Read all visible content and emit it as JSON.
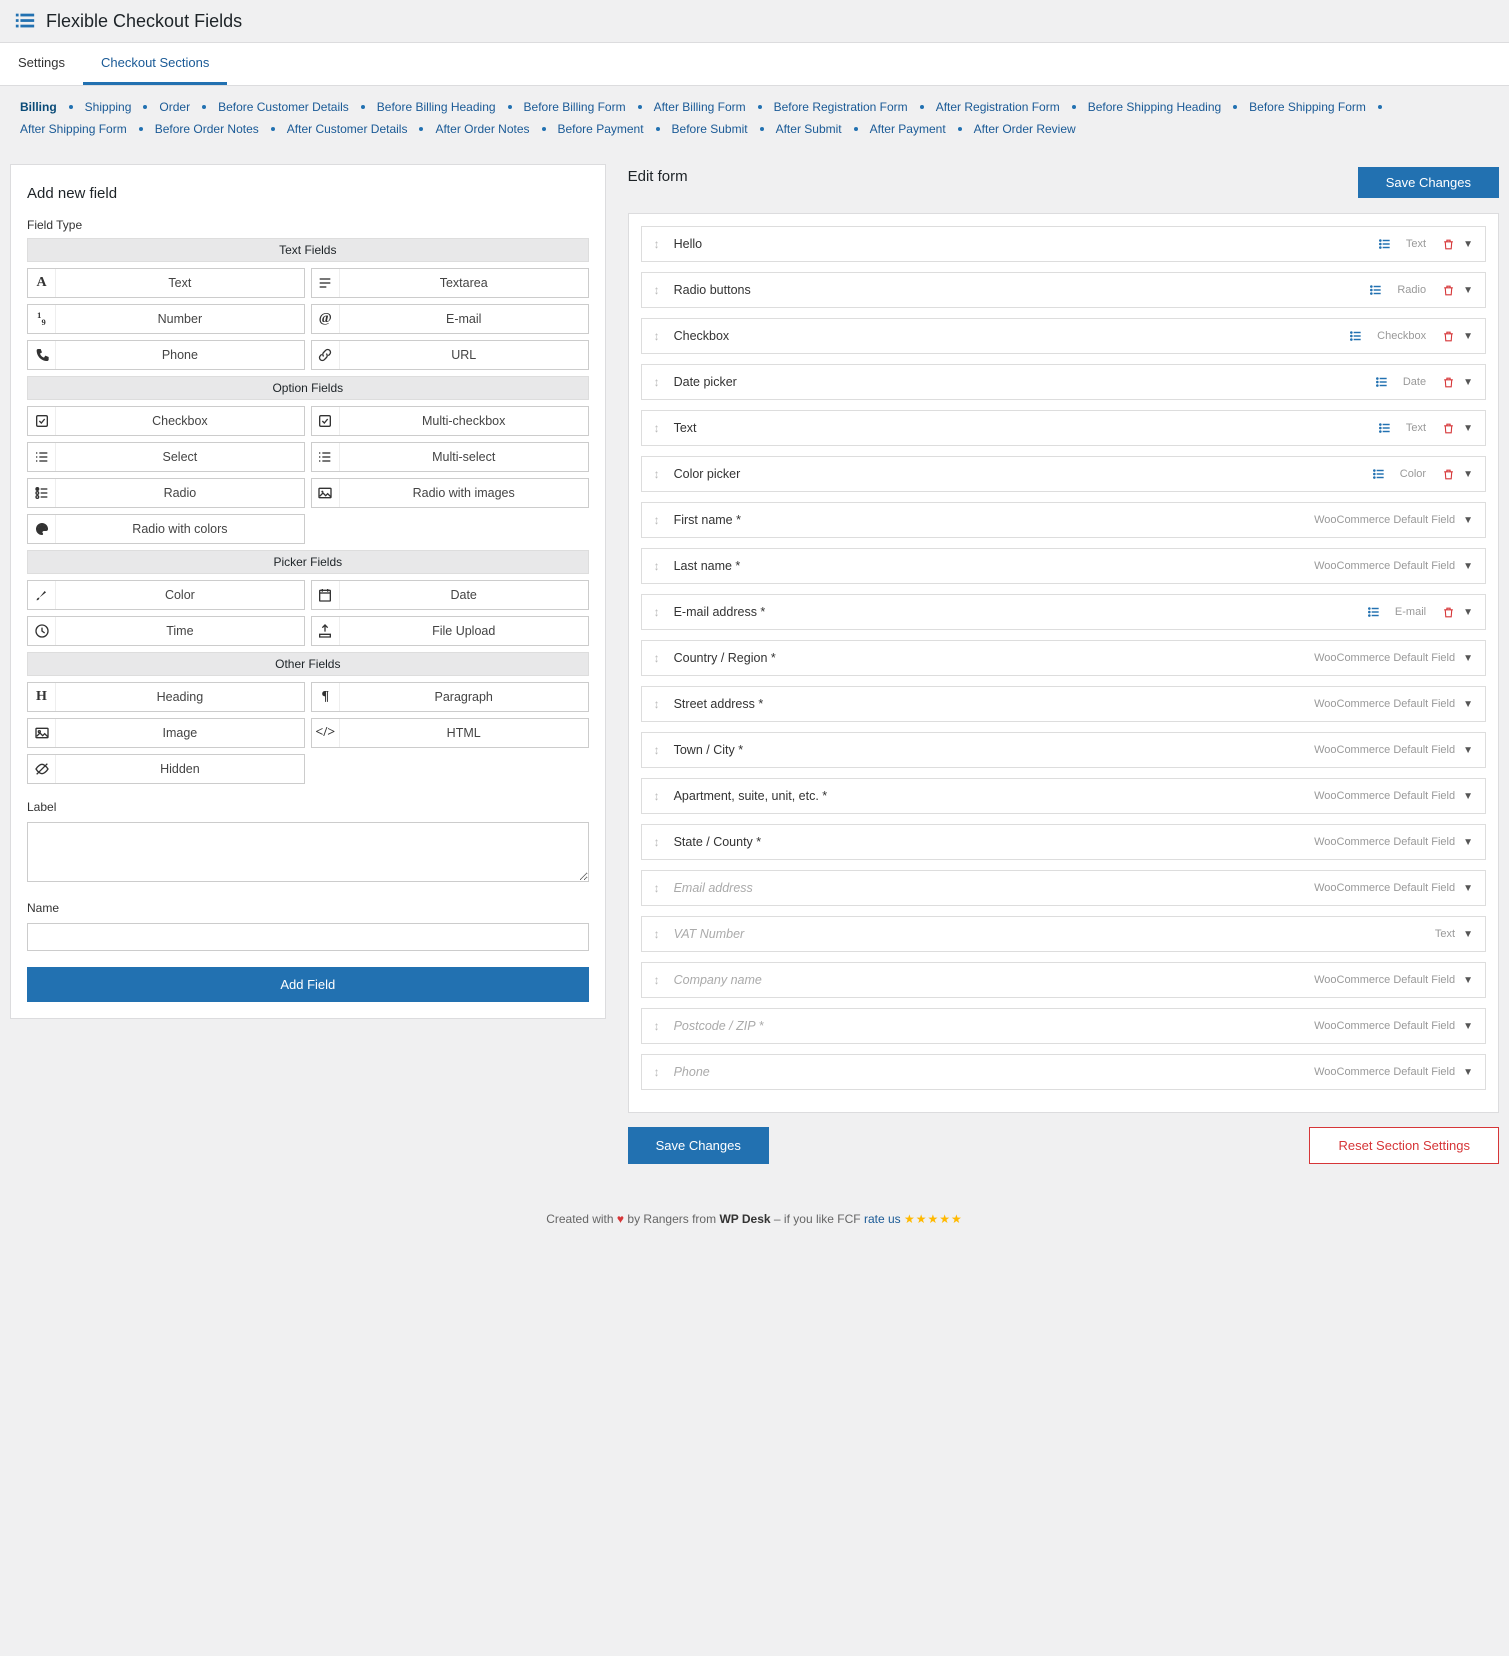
{
  "header": {
    "title": "Flexible Checkout Fields"
  },
  "tabs": [
    {
      "label": "Settings",
      "active": false
    },
    {
      "label": "Checkout Sections",
      "active": true
    }
  ],
  "sections": [
    "Billing",
    "Shipping",
    "Order",
    "Before Customer Details",
    "Before Billing Heading",
    "Before Billing Form",
    "After Billing Form",
    "Before Registration Form",
    "After Registration Form",
    "Before Shipping Heading",
    "Before Shipping Form",
    "After Shipping Form",
    "Before Order Notes",
    "After Customer Details",
    "After Order Notes",
    "Before Payment",
    "Before Submit",
    "After Submit",
    "After Payment",
    "After Order Review"
  ],
  "section_active": 0,
  "left": {
    "title": "Add new field",
    "field_type_label": "Field Type",
    "label_label": "Label",
    "name_label": "Name",
    "label_value": "",
    "name_value": "",
    "add_btn": "Add Field",
    "groups": [
      {
        "header": "Text Fields",
        "types": [
          {
            "icon": "A",
            "kind": "glyph",
            "label": "Text"
          },
          {
            "icon": "textarea",
            "kind": "svg",
            "label": "Textarea"
          },
          {
            "icon": "¹₉",
            "kind": "glyph",
            "label": "Number"
          },
          {
            "icon": "@",
            "kind": "glyph",
            "label": "E-mail"
          },
          {
            "icon": "phone",
            "kind": "svg",
            "label": "Phone"
          },
          {
            "icon": "link",
            "kind": "svg",
            "label": "URL"
          }
        ]
      },
      {
        "header": "Option Fields",
        "types": [
          {
            "icon": "checkbox",
            "kind": "svg",
            "label": "Checkbox"
          },
          {
            "icon": "checkbox",
            "kind": "svg",
            "label": "Multi-checkbox"
          },
          {
            "icon": "select",
            "kind": "svg",
            "label": "Select"
          },
          {
            "icon": "select",
            "kind": "svg",
            "label": "Multi-select"
          },
          {
            "icon": "radio",
            "kind": "svg",
            "label": "Radio"
          },
          {
            "icon": "radioimg",
            "kind": "svg",
            "label": "Radio with images"
          },
          {
            "icon": "palette",
            "kind": "svg",
            "label": "Radio with colors"
          }
        ]
      },
      {
        "header": "Picker Fields",
        "types": [
          {
            "icon": "brush",
            "kind": "svg",
            "label": "Color"
          },
          {
            "icon": "calendar",
            "kind": "svg",
            "label": "Date"
          },
          {
            "icon": "clock",
            "kind": "svg",
            "label": "Time"
          },
          {
            "icon": "upload",
            "kind": "svg",
            "label": "File Upload"
          }
        ]
      },
      {
        "header": "Other Fields",
        "types": [
          {
            "icon": "H",
            "kind": "glyph",
            "label": "Heading"
          },
          {
            "icon": "¶",
            "kind": "glyph",
            "label": "Paragraph"
          },
          {
            "icon": "image",
            "kind": "svg",
            "label": "Image"
          },
          {
            "icon": "</>",
            "kind": "glyph",
            "label": "HTML"
          },
          {
            "icon": "hidden",
            "kind": "svg",
            "label": "Hidden"
          }
        ]
      }
    ]
  },
  "right": {
    "title": "Edit form",
    "save_btn": "Save Changes",
    "reset_btn": "Reset Section Settings",
    "rows": [
      {
        "title": "Hello",
        "badge": "Text",
        "list_icon": true,
        "trash": true,
        "disabled": false
      },
      {
        "title": "Radio buttons",
        "badge": "Radio",
        "list_icon": true,
        "trash": true,
        "disabled": false
      },
      {
        "title": "Checkbox",
        "badge": "Checkbox",
        "list_icon": true,
        "trash": true,
        "disabled": false
      },
      {
        "title": "Date picker",
        "badge": "Date",
        "list_icon": true,
        "trash": true,
        "disabled": false
      },
      {
        "title": "Text",
        "badge": "Text",
        "list_icon": true,
        "trash": true,
        "disabled": false
      },
      {
        "title": "Color picker",
        "badge": "Color",
        "list_icon": true,
        "trash": true,
        "disabled": false
      },
      {
        "title": "First name *",
        "badge": "WooCommerce Default Field",
        "list_icon": false,
        "trash": false,
        "disabled": false
      },
      {
        "title": "Last name *",
        "badge": "WooCommerce Default Field",
        "list_icon": false,
        "trash": false,
        "disabled": false
      },
      {
        "title": "E-mail address *",
        "badge": "E-mail",
        "list_icon": true,
        "trash": true,
        "disabled": false
      },
      {
        "title": "Country / Region *",
        "badge": "WooCommerce Default Field",
        "list_icon": false,
        "trash": false,
        "disabled": false
      },
      {
        "title": "Street address *",
        "badge": "WooCommerce Default Field",
        "list_icon": false,
        "trash": false,
        "disabled": false
      },
      {
        "title": "Town / City *",
        "badge": "WooCommerce Default Field",
        "list_icon": false,
        "trash": false,
        "disabled": false
      },
      {
        "title": "Apartment, suite, unit, etc. *",
        "badge": "WooCommerce Default Field",
        "list_icon": false,
        "trash": false,
        "disabled": false
      },
      {
        "title": "State / County *",
        "badge": "WooCommerce Default Field",
        "list_icon": false,
        "trash": false,
        "disabled": false
      },
      {
        "title": "Email address",
        "badge": "WooCommerce Default Field",
        "list_icon": false,
        "trash": false,
        "disabled": true
      },
      {
        "title": "VAT Number",
        "badge": "Text",
        "list_icon": false,
        "trash": false,
        "disabled": true
      },
      {
        "title": "Company name",
        "badge": "WooCommerce Default Field",
        "list_icon": false,
        "trash": false,
        "disabled": true
      },
      {
        "title": "Postcode / ZIP *",
        "badge": "WooCommerce Default Field",
        "list_icon": false,
        "trash": false,
        "disabled": true
      },
      {
        "title": "Phone",
        "badge": "WooCommerce Default Field",
        "list_icon": false,
        "trash": false,
        "disabled": true
      }
    ]
  },
  "credits": {
    "pre": "Created with",
    "mid": "by Rangers from",
    "brand": "WP Desk",
    "post": "– if you like FCF",
    "link": "rate us"
  }
}
